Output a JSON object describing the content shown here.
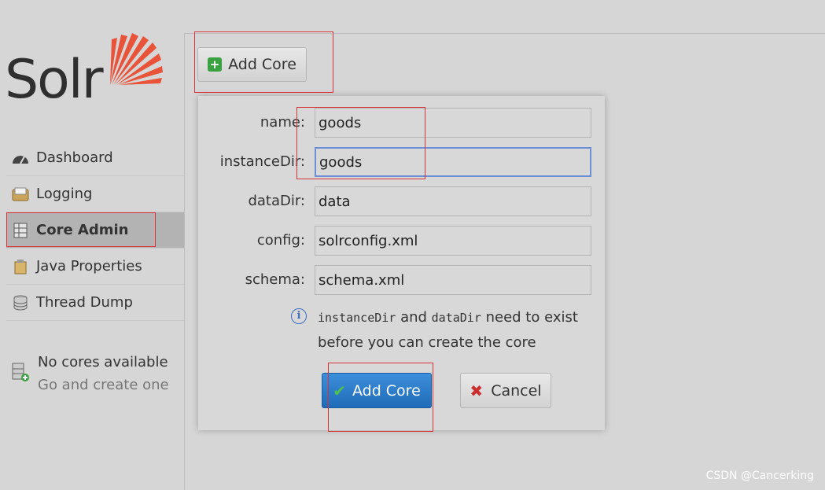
{
  "logo": {
    "text": "Solr"
  },
  "sidebar": {
    "items": [
      {
        "label": "Dashboard",
        "icon": "dashboard-icon",
        "active": false
      },
      {
        "label": "Logging",
        "icon": "logging-icon",
        "active": false
      },
      {
        "label": "Core Admin",
        "icon": "core-admin-icon",
        "active": true
      },
      {
        "label": "Java Properties",
        "icon": "java-properties-icon",
        "active": false
      },
      {
        "label": "Thread Dump",
        "icon": "thread-dump-icon",
        "active": false
      }
    ],
    "no_cores": {
      "title": "No cores available",
      "subtitle": "Go and create one",
      "icon": "add-core-db-icon"
    }
  },
  "toolbar": {
    "add_core_label": "Add Core"
  },
  "dialog": {
    "fields": [
      {
        "label": "name:",
        "value": "goods"
      },
      {
        "label": "instanceDir:",
        "value": "goods"
      },
      {
        "label": "dataDir:",
        "value": "data"
      },
      {
        "label": "config:",
        "value": "solrconfig.xml"
      },
      {
        "label": "schema:",
        "value": "schema.xml"
      }
    ],
    "note": {
      "code1": "instanceDir",
      "and": " and ",
      "code2": "dataDir",
      "line1_rest": " need to exist",
      "line2": "before you can create the core"
    },
    "submit_label": "Add Core",
    "cancel_label": "Cancel"
  },
  "watermark": "CSDN @Cancerking",
  "colors": {
    "accent_blue": "#1f6bb8",
    "annotation_red": "#d9343a",
    "logo_orange": "#e8533a"
  }
}
